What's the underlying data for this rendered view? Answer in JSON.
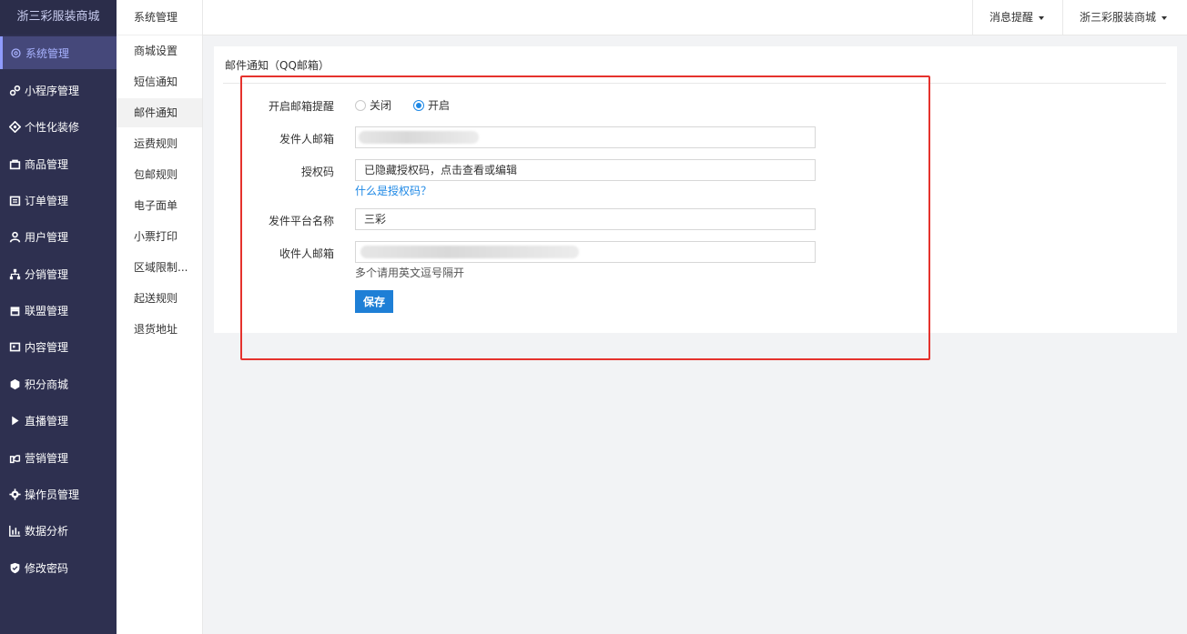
{
  "brand": "浙三彩服装商城",
  "sidebar": {
    "items": [
      {
        "label": "系统管理",
        "icon": "gear-icon"
      },
      {
        "label": "小程序管理",
        "icon": "link-icon"
      },
      {
        "label": "个性化装修",
        "icon": "diamond-icon"
      },
      {
        "label": "商品管理",
        "icon": "bag-icon"
      },
      {
        "label": "订单管理",
        "icon": "calendar-icon"
      },
      {
        "label": "用户管理",
        "icon": "user-icon"
      },
      {
        "label": "分销管理",
        "icon": "sitemap-icon"
      },
      {
        "label": "联盟管理",
        "icon": "store-icon"
      },
      {
        "label": "内容管理",
        "icon": "newspaper-icon"
      },
      {
        "label": "积分商城",
        "icon": "cube-icon"
      },
      {
        "label": "直播管理",
        "icon": "play-icon"
      },
      {
        "label": "营销管理",
        "icon": "handshake-icon"
      },
      {
        "label": "操作员管理",
        "icon": "cog-icon"
      },
      {
        "label": "数据分析",
        "icon": "bar-chart-icon"
      },
      {
        "label": "修改密码",
        "icon": "shield-icon"
      }
    ]
  },
  "submenu": {
    "title": "系统管理",
    "items": [
      "商城设置",
      "短信通知",
      "邮件通知",
      "运费规则",
      "包邮规则",
      "电子面单",
      "小票打印",
      "区域限制...",
      "起送规则",
      "退货地址"
    ]
  },
  "topbar": {
    "notifications": "消息提醒",
    "account": "浙三彩服装商城"
  },
  "form": {
    "title": "邮件通知（QQ邮箱）",
    "enable_label": "开启邮箱提醒",
    "option_off": "关闭",
    "option_on": "开启",
    "selected": "开启",
    "sender_label": "发件人邮箱",
    "auth_label": "授权码",
    "auth_value": "已隐藏授权码，点击查看或编辑",
    "auth_link": "什么是授权码？",
    "platform_label": "发件平台名称",
    "platform_value": "三彩",
    "receiver_label": "收件人邮箱",
    "receiver_hint": "多个请用英文逗号隔开",
    "save": "保存"
  },
  "colors": {
    "sidebar_bg": "#2e3050",
    "accent": "#1e7fd6",
    "highlight": "#e5322d"
  }
}
